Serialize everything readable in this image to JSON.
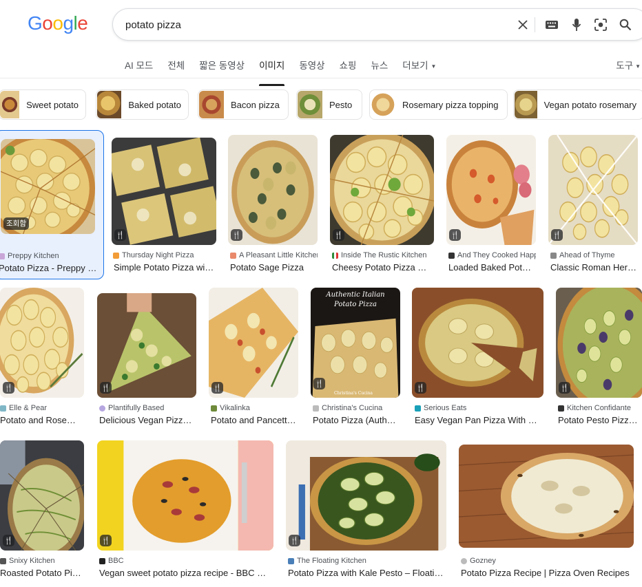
{
  "logo": {
    "text": "Google"
  },
  "search": {
    "query": "potato pizza"
  },
  "tabs": [
    {
      "label": "AI 모드"
    },
    {
      "label": "전체"
    },
    {
      "label": "짧은 동영상"
    },
    {
      "label": "이미지"
    },
    {
      "label": "동영상"
    },
    {
      "label": "쇼핑"
    },
    {
      "label": "뉴스"
    },
    {
      "label": "더보기"
    }
  ],
  "tools_label": "도구",
  "chips": [
    {
      "label": "Sweet potato"
    },
    {
      "label": "Baked potato"
    },
    {
      "label": "Bacon pizza"
    },
    {
      "label": "Pesto"
    },
    {
      "label": "Rosemary pizza topping"
    },
    {
      "label": "Vegan potato rosemary"
    }
  ],
  "results": [
    {
      "source": "Preppy Kitchen",
      "title": "Potato Pizza - Preppy Kitchen",
      "badge": "조회함"
    },
    {
      "source": "Thursday Night Pizza",
      "title": "Simple Potato Pizza with Rosemary"
    },
    {
      "source": "A Pleasant Little Kitchen",
      "title": "Potato Sage Pizza"
    },
    {
      "source": "Inside The Rustic Kitchen",
      "title": "Cheesy Potato Pizza Recipe"
    },
    {
      "source": "And They Cooked Happily Ever After",
      "title": "Loaded Baked Potato Pizza"
    },
    {
      "source": "Ahead of Thyme",
      "title": "Classic Roman Herb Potato Pizza"
    },
    {
      "source": "Elle & Pear",
      "title": "Potato and Rosemary Pizza"
    },
    {
      "source": "Plantifully Based",
      "title": "Delicious Vegan Pizza with Potatoes"
    },
    {
      "source": "Vikalinka",
      "title": "Potato and Pancetta Pizza"
    },
    {
      "source": "Christina's Cucina",
      "title": "Potato Pizza (Authentic Italian)"
    },
    {
      "source": "Serious Eats",
      "title": "Easy Vegan Pan Pizza With Potatoes"
    },
    {
      "source": "Kitchen Confidante",
      "title": "Potato Pesto Pizza Recipe"
    },
    {
      "source": "Snixy Kitchen",
      "title": "Roasted Potato Pizza"
    },
    {
      "source": "BBC",
      "title": "Vegan sweet potato pizza recipe - BBC Food"
    },
    {
      "source": "The Floating Kitchen",
      "title": "Potato Pizza with Kale Pesto – Floating Kitchen"
    },
    {
      "source": "Gozney",
      "title": "Potato Pizza Recipe | Pizza Oven Recipes"
    }
  ],
  "overlay_text": {
    "line1": "Authentic Italian",
    "line2": "Potato Pizza",
    "credit": "Christina's Cucina"
  },
  "colors": {
    "accent": "#1a73e8",
    "text": "#1f1f1f",
    "muted": "#4d5156"
  },
  "icons": [
    "clear-icon",
    "keyboard-icon",
    "mic-icon",
    "lens-icon",
    "search-icon",
    "recipe-icon"
  ]
}
